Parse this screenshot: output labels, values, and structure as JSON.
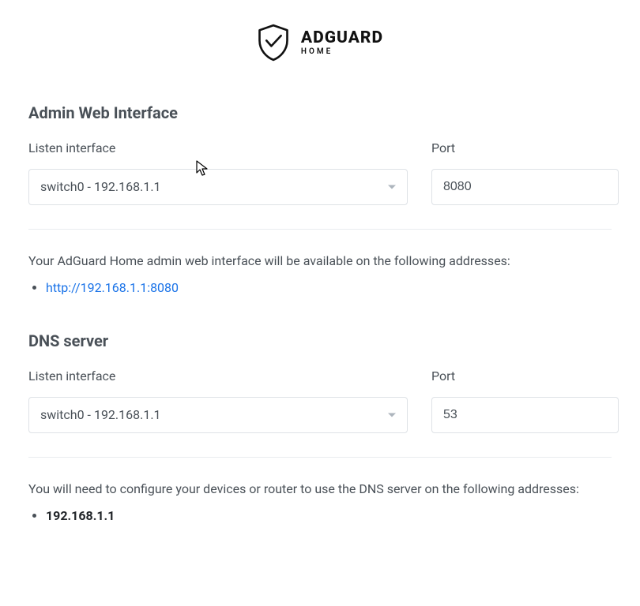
{
  "logo": {
    "main": "ADGUARD",
    "sub": "HOME"
  },
  "admin": {
    "heading": "Admin Web Interface",
    "interface_label": "Listen interface",
    "interface_selected": "switch0 - 192.168.1.1",
    "port_label": "Port",
    "port_value": "8080",
    "info": "Your AdGuard Home admin web interface will be available on the following addresses:",
    "addresses": [
      "http://192.168.1.1:8080"
    ]
  },
  "dns": {
    "heading": "DNS server",
    "interface_label": "Listen interface",
    "interface_selected": "switch0 - 192.168.1.1",
    "port_label": "Port",
    "port_value": "53",
    "info": "You will need to configure your devices or router to use the DNS server on the following addresses:",
    "addresses": [
      "192.168.1.1"
    ]
  }
}
